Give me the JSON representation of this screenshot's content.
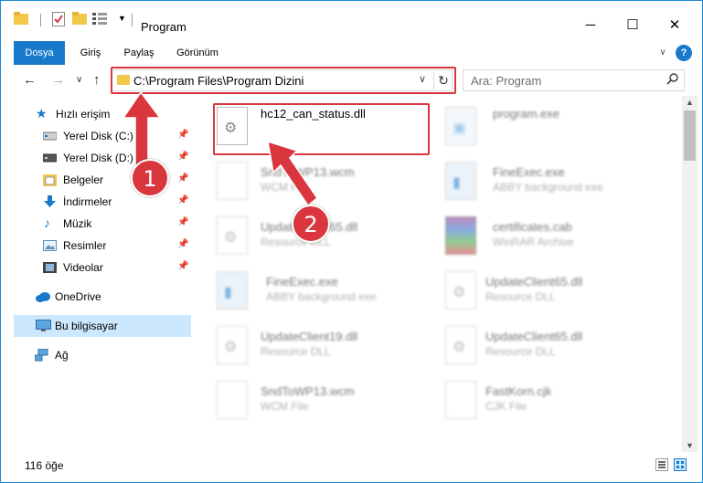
{
  "window": {
    "title": "Program",
    "controls": {
      "minimize": "─",
      "maximize": "☐",
      "close": "✕"
    }
  },
  "ribbon": {
    "tabs": [
      {
        "label": "Dosya"
      },
      {
        "label": "Giriş"
      },
      {
        "label": "Paylaş"
      },
      {
        "label": "Görünüm"
      }
    ],
    "expand": "∨",
    "help": "?"
  },
  "nav": {
    "back": "←",
    "forward": "→",
    "recent": "∨",
    "up": "↑"
  },
  "address": {
    "path": "C:\\Program Files\\Program Dizini",
    "dropdown": "∨",
    "refresh": "↻"
  },
  "search": {
    "placeholder": "Ara: Program",
    "icon": "search-icon"
  },
  "sidebar": {
    "items": [
      {
        "label": "Hızlı erişim",
        "icon": "star-icon",
        "pinned": false
      },
      {
        "label": "Yerel Disk (C:)",
        "icon": "drive-icon",
        "pinned": true
      },
      {
        "label": "Yerel Disk (D:)",
        "icon": "drive-icon",
        "pinned": true
      },
      {
        "label": "Belgeler",
        "icon": "documents-icon",
        "pinned": true
      },
      {
        "label": "İndirmeler",
        "icon": "download-icon",
        "pinned": true
      },
      {
        "label": "Müzik",
        "icon": "music-icon",
        "pinned": true
      },
      {
        "label": "Resimler",
        "icon": "pictures-icon",
        "pinned": true
      },
      {
        "label": "Videolar",
        "icon": "video-icon",
        "pinned": true
      },
      {
        "label": "OneDrive",
        "icon": "cloud-icon",
        "pinned": false
      },
      {
        "label": "Bu bilgisayar",
        "icon": "computer-icon",
        "pinned": false,
        "selected": true
      },
      {
        "label": "Ağ",
        "icon": "network-icon",
        "pinned": false
      }
    ],
    "pin_glyph": "📌"
  },
  "files": [
    {
      "name": "hc12_can_status.dll",
      "type": "",
      "icon": "dll-gear-icon",
      "highlighted": true
    },
    {
      "name": "program.exe",
      "type": "",
      "icon": "exe-icon"
    },
    {
      "name": "SndToWP13.wcm",
      "type": "WCM File",
      "icon": "blank-file-icon"
    },
    {
      "name": "FineExec.exe",
      "type": "ABBY background exe",
      "icon": "exe-icon"
    },
    {
      "name": "UpdateClient65.dll",
      "type": "Resource DLL",
      "icon": "dll-gear-icon"
    },
    {
      "name": "certificates.cab",
      "type": "WinRAR Archive",
      "icon": "archive-icon"
    },
    {
      "name": "FineExec.exe",
      "type": "ABBY background exe",
      "icon": "exe-icon"
    },
    {
      "name": "UpdateClient65.dll",
      "type": "Resource DLL",
      "icon": "dll-gear-icon"
    },
    {
      "name": "UpdateClient19.dll",
      "type": "Resource DLL",
      "icon": "dll-gear-icon"
    },
    {
      "name": "UpdateClient65.dll",
      "type": "Resource DLL",
      "icon": "dll-gear-icon"
    },
    {
      "name": "SndToWP13.wcm",
      "type": "WCM File",
      "icon": "blank-file-icon"
    },
    {
      "name": "FastKorn.cjk",
      "type": "CJK File",
      "icon": "blank-file-icon"
    }
  ],
  "annotations": {
    "step1": "1",
    "step2": "2"
  },
  "status": {
    "count": "116 öğe"
  },
  "colors": {
    "accent": "#1979ca",
    "highlight": "#d9363e",
    "selection": "#cce8ff"
  }
}
